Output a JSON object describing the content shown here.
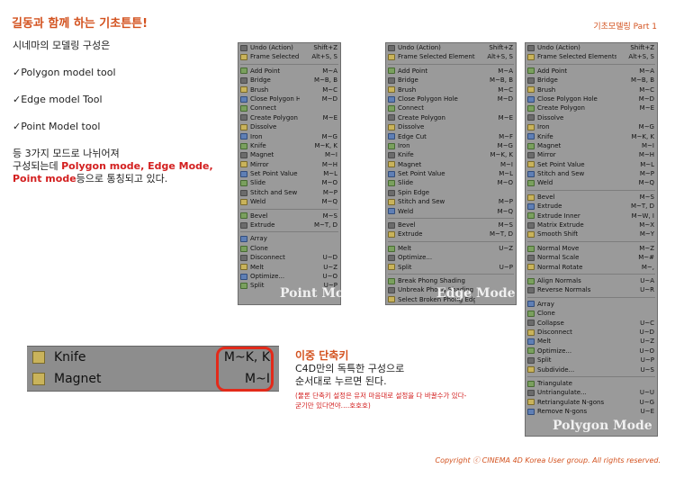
{
  "title": "길동과 함께 하는 기초튼튼!",
  "page_tag": "기초모델링 Part 1",
  "intro": {
    "line1": "시네마의 모델링 구성은",
    "tool1": "✓Polygon model tool",
    "tool2": "✓Edge model Tool",
    "tool3": "✓Point Model tool",
    "para1": "등 3가지 모드로 나뉘어져",
    "para2": "구성되는데 ",
    "hl1": "Polygon mode, Edge Mode,",
    "hl2": "Point mode",
    "para3": "등으로 통칭되고 있다."
  },
  "menus": {
    "point": {
      "watermark": "Point Mode",
      "items": [
        {
          "label": "Undo (Action)",
          "key": "Shift+Z"
        },
        {
          "label": "Frame Selected Elements",
          "key": "Alt+S, S"
        },
        {
          "sep": true
        },
        {
          "label": "Add Point",
          "key": "M~A"
        },
        {
          "label": "Bridge",
          "key": "M~B, B"
        },
        {
          "label": "Brush",
          "key": "M~C"
        },
        {
          "label": "Close Polygon Hole",
          "key": "M~D"
        },
        {
          "label": "Connect",
          "key": ""
        },
        {
          "label": "Create Polygon",
          "key": "M~E"
        },
        {
          "label": "Dissolve",
          "key": ""
        },
        {
          "label": "Iron",
          "key": "M~G"
        },
        {
          "label": "Knife",
          "key": "M~K, K"
        },
        {
          "label": "Magnet",
          "key": "M~I"
        },
        {
          "label": "Mirror",
          "key": "M~H"
        },
        {
          "label": "Set Point Value",
          "key": "M~L"
        },
        {
          "label": "Slide",
          "key": "M~O"
        },
        {
          "label": "Stitch and Sew",
          "key": "M~P"
        },
        {
          "label": "Weld",
          "key": "M~Q"
        },
        {
          "sep": true
        },
        {
          "label": "Bevel",
          "key": "M~S"
        },
        {
          "label": "Extrude",
          "key": "M~T, D"
        },
        {
          "sep": true
        },
        {
          "label": "Array",
          "key": ""
        },
        {
          "label": "Clone",
          "key": ""
        },
        {
          "label": "Disconnect",
          "key": "U~D"
        },
        {
          "label": "Melt",
          "key": "U~Z"
        },
        {
          "label": "Optimize...",
          "key": "U~O"
        },
        {
          "label": "Split",
          "key": "U~P"
        }
      ]
    },
    "edge": {
      "watermark": "Edge Mode",
      "items": [
        {
          "label": "Undo (Action)",
          "key": "Shift+Z"
        },
        {
          "label": "Frame Selected Elements",
          "key": "Alt+S, S"
        },
        {
          "sep": true
        },
        {
          "label": "Add Point",
          "key": "M~A"
        },
        {
          "label": "Bridge",
          "key": "M~B, B"
        },
        {
          "label": "Brush",
          "key": "M~C"
        },
        {
          "label": "Close Polygon Hole",
          "key": "M~D"
        },
        {
          "label": "Connect",
          "key": ""
        },
        {
          "label": "Create Polygon",
          "key": "M~E"
        },
        {
          "label": "Dissolve",
          "key": ""
        },
        {
          "label": "Edge Cut",
          "key": "M~F"
        },
        {
          "label": "Iron",
          "key": "M~G"
        },
        {
          "label": "Knife",
          "key": "M~K, K"
        },
        {
          "label": "Magnet",
          "key": "M~I"
        },
        {
          "label": "Set Point Value",
          "key": "M~L"
        },
        {
          "label": "Slide",
          "key": "M~O"
        },
        {
          "label": "Spin Edge",
          "key": ""
        },
        {
          "label": "Stitch and Sew",
          "key": "M~P"
        },
        {
          "label": "Weld",
          "key": "M~Q"
        },
        {
          "sep": true
        },
        {
          "label": "Bevel",
          "key": "M~S"
        },
        {
          "label": "Extrude",
          "key": "M~T, D"
        },
        {
          "sep": true
        },
        {
          "label": "Melt",
          "key": "U~Z"
        },
        {
          "label": "Optimize...",
          "key": ""
        },
        {
          "label": "Split",
          "key": "U~P"
        },
        {
          "sep": true
        },
        {
          "label": "Break Phong Shading",
          "key": ""
        },
        {
          "label": "Unbreak Phong Shading",
          "key": ""
        },
        {
          "label": "Select Broken Phong Edges",
          "key": ""
        }
      ]
    },
    "polygon": {
      "watermark": "Polygon Mode",
      "items": [
        {
          "label": "Undo (Action)",
          "key": "Shift+Z"
        },
        {
          "label": "Frame Selected Elements",
          "key": "Alt+S, S"
        },
        {
          "sep": true
        },
        {
          "label": "Add Point",
          "key": "M~A"
        },
        {
          "label": "Bridge",
          "key": "M~B, B"
        },
        {
          "label": "Brush",
          "key": "M~C"
        },
        {
          "label": "Close Polygon Hole",
          "key": "M~D"
        },
        {
          "label": "Create Polygon",
          "key": "M~E"
        },
        {
          "label": "Dissolve",
          "key": ""
        },
        {
          "label": "Iron",
          "key": "M~G"
        },
        {
          "label": "Knife",
          "key": "M~K, K"
        },
        {
          "label": "Magnet",
          "key": "M~I"
        },
        {
          "label": "Mirror",
          "key": "M~H"
        },
        {
          "label": "Set Point Value",
          "key": "M~L"
        },
        {
          "label": "Stitch and Sew",
          "key": "M~P"
        },
        {
          "label": "Weld",
          "key": "M~Q"
        },
        {
          "sep": true
        },
        {
          "label": "Bevel",
          "key": "M~S"
        },
        {
          "label": "Extrude",
          "key": "M~T, D"
        },
        {
          "label": "Extrude Inner",
          "key": "M~W, I"
        },
        {
          "label": "Matrix Extrude",
          "key": "M~X"
        },
        {
          "label": "Smooth Shift",
          "key": "M~Y"
        },
        {
          "sep": true
        },
        {
          "label": "Normal Move",
          "key": "M~Z"
        },
        {
          "label": "Normal Scale",
          "key": "M~#"
        },
        {
          "label": "Normal Rotate",
          "key": "M~,"
        },
        {
          "sep": true
        },
        {
          "label": "Align Normals",
          "key": "U~A"
        },
        {
          "label": "Reverse Normals",
          "key": "U~R"
        },
        {
          "sep": true
        },
        {
          "label": "Array",
          "key": ""
        },
        {
          "label": "Clone",
          "key": ""
        },
        {
          "label": "Collapse",
          "key": "U~C"
        },
        {
          "label": "Disconnect",
          "key": "U~D"
        },
        {
          "label": "Melt",
          "key": "U~Z"
        },
        {
          "label": "Optimize...",
          "key": "U~O"
        },
        {
          "label": "Split",
          "key": "U~P"
        },
        {
          "label": "Subdivide...",
          "key": "U~S"
        },
        {
          "sep": true
        },
        {
          "label": "Triangulate",
          "key": ""
        },
        {
          "label": "Untriangulate...",
          "key": "U~U"
        },
        {
          "label": "Retriangulate N-gons",
          "key": "U~G"
        },
        {
          "label": "Remove N-gons",
          "key": "U~E"
        }
      ]
    }
  },
  "zoom": {
    "knife_label": "Knife",
    "knife_key": "M~K, K",
    "magnet_label": "Magnet",
    "magnet_key": "M~I"
  },
  "note": {
    "heading": "이중 단축키",
    "line1": "C4D만의 독특한 구성으로",
    "line2": "순서대로 누르면 된다.",
    "small1": "(물론 단축키 설정은 유저 마음대로 설정을 다 바꿀수가 있다-",
    "small2": "굳기만 있다면야....호호호)"
  },
  "copyright": "Copyright ⓒ CINEMA 4D Korea User group. All rights reserved."
}
